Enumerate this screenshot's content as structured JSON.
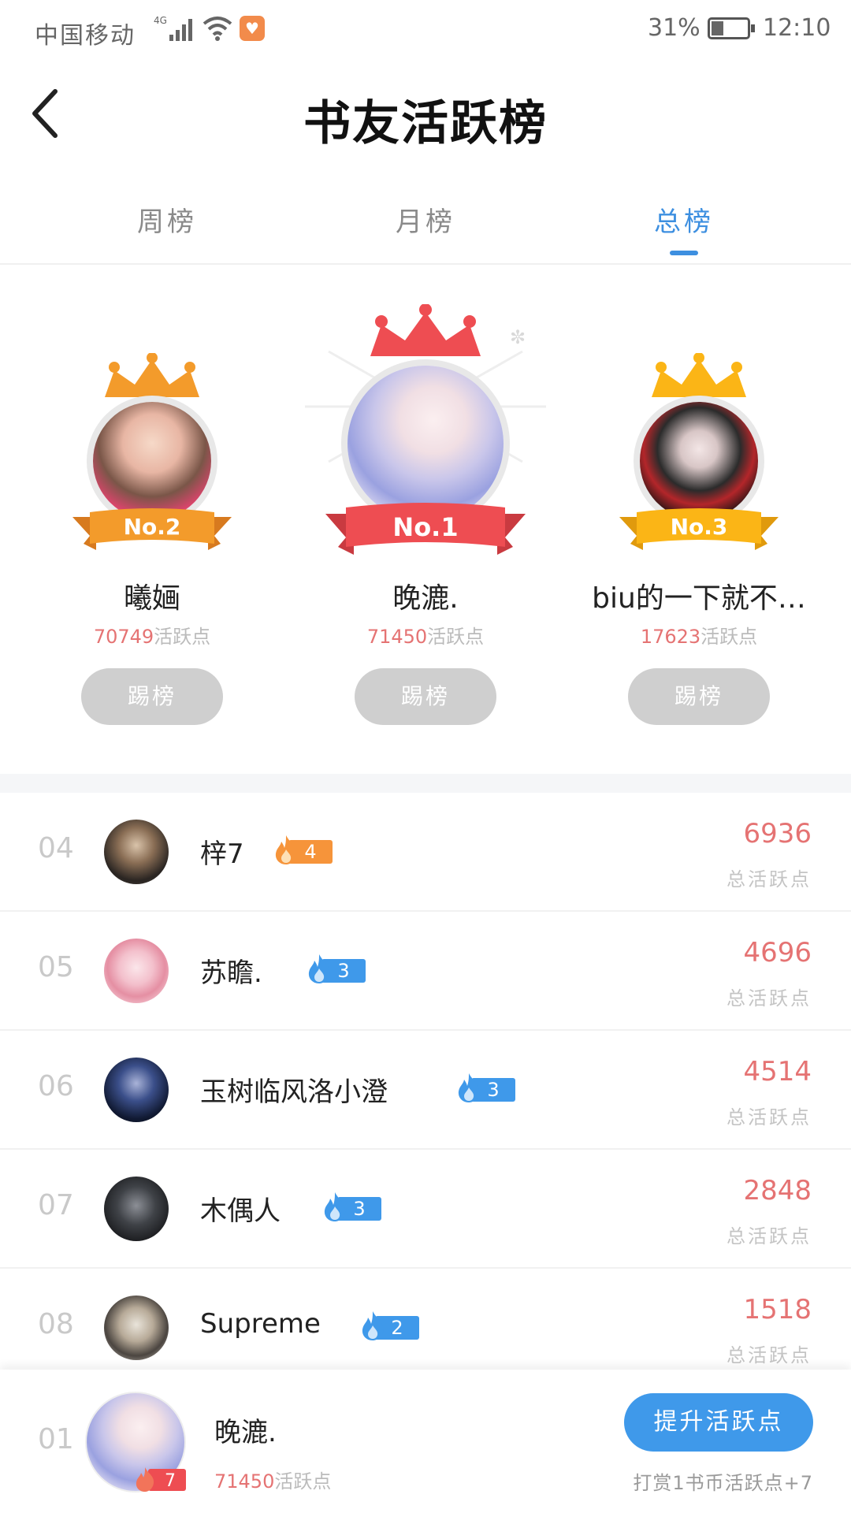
{
  "status_bar": {
    "carrier": "中国移动",
    "network": "4G",
    "battery_percent": "31%",
    "battery_level": 0.31,
    "time": "12:10",
    "icons": [
      "signal-icon",
      "wifi-icon",
      "health-app-icon",
      "battery-icon"
    ]
  },
  "header": {
    "title": "书友活跃榜",
    "back_icon": "chevron-left-icon"
  },
  "tabs": [
    {
      "label": "周榜",
      "active": false
    },
    {
      "label": "月榜",
      "active": false
    },
    {
      "label": "总榜",
      "active": true
    }
  ],
  "podium": [
    {
      "rank_label": "No.2",
      "name": "曦婳",
      "score": "70749",
      "score_unit": "活跃点",
      "button": "踢榜",
      "crown_color": "#f39b2b"
    },
    {
      "rank_label": "No.1",
      "name": "晚漉.",
      "score": "71450",
      "score_unit": "活跃点",
      "button": "踢榜",
      "crown_color": "#ee4d52"
    },
    {
      "rank_label": "No.3",
      "name": "biu的一下就不…",
      "score": "17623",
      "score_unit": "活跃点",
      "button": "踢榜",
      "crown_color": "#fbb516"
    }
  ],
  "list": [
    {
      "rank": "04",
      "name": "梓7",
      "badge": "4",
      "badge_color": "#f6943a",
      "score": "6936",
      "score_label": "总活跃点"
    },
    {
      "rank": "05",
      "name": "苏瞻.",
      "badge": "3",
      "badge_color": "#3f99ea",
      "score": "4696",
      "score_label": "总活跃点"
    },
    {
      "rank": "06",
      "name": "玉树临风洛小澄",
      "badge": "3",
      "badge_color": "#3f99ea",
      "score": "4514",
      "score_label": "总活跃点"
    },
    {
      "rank": "07",
      "name": "木偶人",
      "badge": "3",
      "badge_color": "#3f99ea",
      "score": "2848",
      "score_label": "总活跃点"
    },
    {
      "rank": "08",
      "name": "Supreme",
      "badge": "2",
      "badge_color": "#3f99ea",
      "score": "1518",
      "score_label": "总活跃点"
    }
  ],
  "me": {
    "rank": "01",
    "name": "晚漉.",
    "badge": "7",
    "score": "71450",
    "score_unit": "活跃点",
    "button": "提升活跃点",
    "hint": "打赏1书币活跃点+7"
  },
  "colors": {
    "accent_blue": "#3d8fe0",
    "score_red": "#e57373",
    "badge_orange": "#f6943a",
    "badge_blue": "#3f99ea"
  }
}
